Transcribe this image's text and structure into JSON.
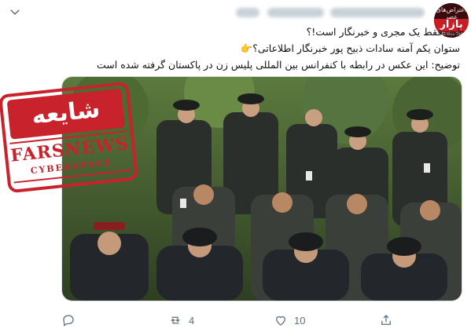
{
  "profile": {
    "avatar_subtitle": "اعتراض‌های عصر",
    "avatar_main": "بازار",
    "avatar_handle": "@Ettelaatbazar"
  },
  "tweet": {
    "lines": [
      "اون فقط یک مجری و خبرنگار است!؟",
      "ستوان یکم آمنه سادات ذبیح پور خبرنگار اطلاعاتی؟",
      "توضیح: این عکس در رابطه با کنفرانس بین المللی پلیس زن در پاکستان گرفته شده است"
    ],
    "emoji": "👉"
  },
  "stamp": {
    "rumor_label": "شایعه",
    "agency": "FARSNEWS",
    "section": "CYBERSPACE"
  },
  "actions": {
    "reply_count": "",
    "retweet_count": "4",
    "like_count": "10",
    "share_count": ""
  },
  "colors": {
    "stamp_red": "#c8232c",
    "action_gray": "#5b7083",
    "uniform_dark": "#2b2f2c",
    "foliage": "#3f5a2c"
  }
}
